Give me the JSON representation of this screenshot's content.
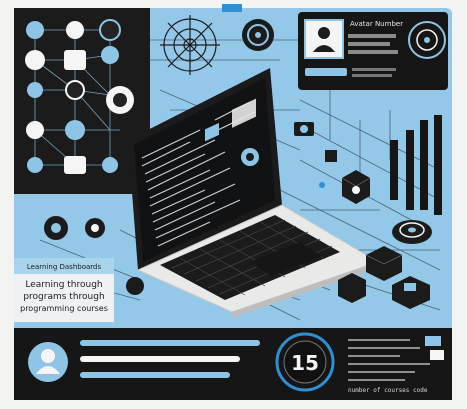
{
  "colors": {
    "dark": "#161616",
    "panel": "#1d1f22",
    "sky": "#8ec5e6",
    "skyLight": "#a9d4ee",
    "accent": "#2f8fd0",
    "white": "#f5f5f5"
  },
  "profile_card": {
    "title": "Avatar Number",
    "icon": "user-icon"
  },
  "caption_box": {
    "heading": "Learning Dashboards",
    "body_line1": "Learning through",
    "body_line2": "programs through",
    "body_line3": "programming courses"
  },
  "bottom_panel": {
    "icon": "user-icon",
    "counter": "15",
    "code_line_last": "number of courses code"
  },
  "laptop": {
    "icon": "laptop-icon"
  }
}
